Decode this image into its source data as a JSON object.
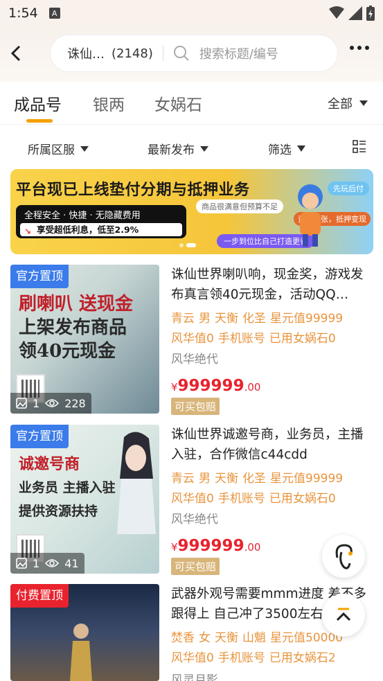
{
  "status_bar": {
    "time": "1:54",
    "a_icon": "A"
  },
  "header": {
    "search": {
      "game_name": "诛仙…",
      "count": "(2148)",
      "placeholder": "搜索标题/编号"
    }
  },
  "tabs": {
    "items": [
      {
        "label": "成品号",
        "active": true
      },
      {
        "label": "银两",
        "active": false
      },
      {
        "label": "女娲石",
        "active": false
      }
    ],
    "all_label": "全部"
  },
  "filters": {
    "region": "所属区服",
    "sort": "最新发布",
    "filter": "筛选"
  },
  "banner": {
    "title": "平台现已上线垫付分期与抵押业务",
    "line1": "全程安全 · 快捷 · 无隐藏费用",
    "line2": "享受超低利息，低至2.9%",
    "tag1": "商品很满意但预算不足",
    "tag2": "先玩后付",
    "tag3": "资金紧张，抵押变现",
    "tag4": "一步到位比自己打造更省"
  },
  "listings": [
    {
      "pin": "官方置顶",
      "pin_color": "#3b7bea",
      "thumb_lines": [
        "刷喇叭 送现金",
        "上架发布商品",
        "领40元现金"
      ],
      "images": "1",
      "views": "228",
      "title": "诛仙世界喇叭响，现金奖，游戏发布真言领40元现金，活动QQ…",
      "attrs": [
        "青云",
        "男",
        "天衡",
        "化圣",
        "星元值99999",
        "风华值0",
        "手机账号",
        "已用女娲石0"
      ],
      "server": "风华绝代",
      "price_symbol": "¥",
      "price_int": "999999",
      "price_dec": ".00",
      "badge": "可买包赔"
    },
    {
      "pin": "官方置顶",
      "pin_color": "#3b7bea",
      "thumb_lines": [
        "诚邀号商",
        "业务员 主播入驻",
        "提供资源扶持"
      ],
      "images": "1",
      "views": "41",
      "title": "诛仙世界诚邀号商，业务员，主播入驻，合作微信c44cdd",
      "attrs": [
        "青云",
        "男",
        "天衡",
        "化圣",
        "星元值99999",
        "风华值0",
        "手机账号",
        "已用女娲石0"
      ],
      "server": "风华绝代",
      "price_symbol": "¥",
      "price_int": "999999",
      "price_dec": ".00",
      "badge": "可买包赔"
    },
    {
      "pin": "付费置顶",
      "pin_color": "#e8232e",
      "thumb_lines": [],
      "images": "",
      "views": "",
      "title": "武器外观号需要mmm进度 差不多跟得上 自己冲了3500左右",
      "attrs": [
        "焚香",
        "女",
        "天衡",
        "山魈",
        "星元值50000",
        "风华值0",
        "手机账号",
        "已用女娲石2"
      ],
      "server": "风灵月影",
      "price_symbol": "",
      "price_int": "",
      "price_dec": "",
      "badge": ""
    }
  ],
  "icons": {
    "back": "back-arrow-icon",
    "search": "search-icon",
    "more": "more-icon",
    "view_toggle": "list-view-icon",
    "customer_service": "customer-service-icon",
    "scroll_top": "scroll-top-icon"
  },
  "colors": {
    "accent": "#f5a000",
    "price": "#e8232e",
    "attr": "#e8943c",
    "badge": "#d8b57a"
  }
}
